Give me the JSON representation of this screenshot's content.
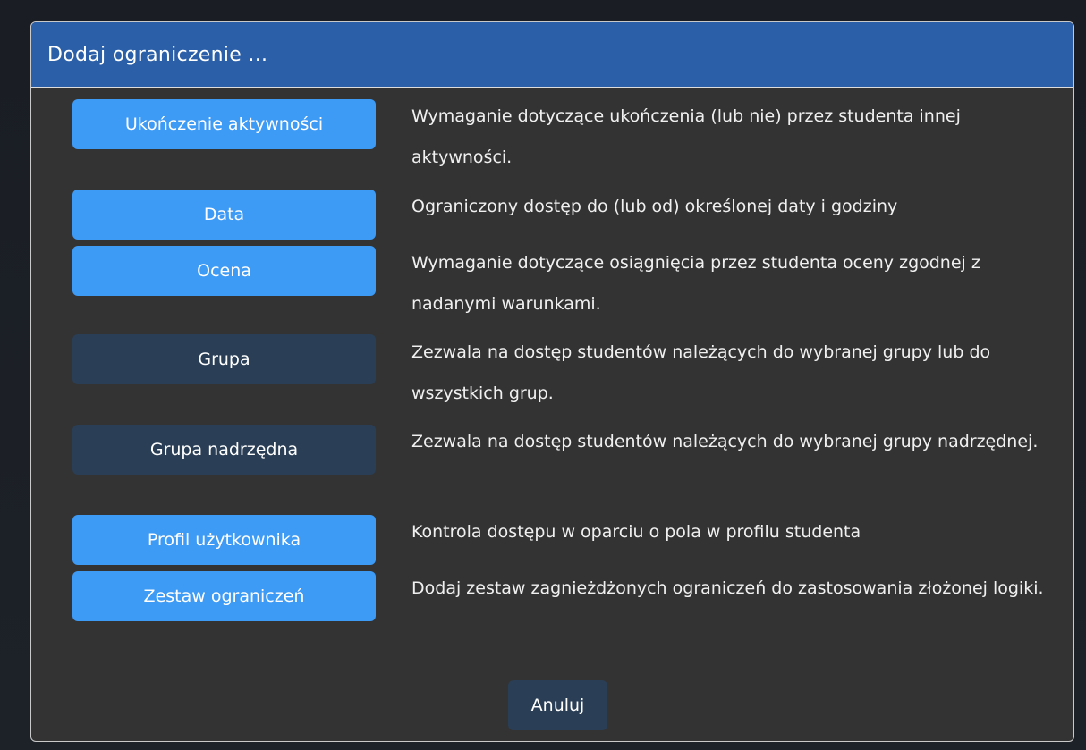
{
  "dialog": {
    "title": "Dodaj ograniczenie ...",
    "options": [
      {
        "label": "Ukończenie aktywności",
        "description": "Wymaganie dotyczące ukończenia (lub nie) przez studenta innej aktywności.",
        "style": "primary"
      },
      {
        "label": "Data",
        "description": "Ograniczony dostęp do (lub od) określonej daty i godziny",
        "style": "primary"
      },
      {
        "label": "Ocena",
        "description": "Wymaganie dotyczące osiągnięcia przez studenta oceny zgodnej z nadanymi warunkami.",
        "style": "primary"
      },
      {
        "label": "Grupa",
        "description": "Zezwala na dostęp studentów należących do wybranej grupy lub do wszystkich grup.",
        "style": "dark"
      },
      {
        "label": "Grupa nadrzędna",
        "description": "Zezwala na dostęp studentów należących do wybranej grupy nadrzędnej.",
        "style": "dark"
      },
      {
        "label": "Profil użytkownika",
        "description": "Kontrola dostępu w oparciu o pola w profilu studenta",
        "style": "primary"
      },
      {
        "label": "Zestaw ograniczeń",
        "description": "Dodaj zestaw zagnieżdżonych ograniczeń do zastosowania złożonej logiki.",
        "style": "primary"
      }
    ],
    "cancel_label": "Anuluj"
  },
  "colors": {
    "header": "#2b5fa8",
    "primary_button": "#3d9af5",
    "disabled_button": "#2a3e55",
    "dialog_bg": "#333333"
  }
}
